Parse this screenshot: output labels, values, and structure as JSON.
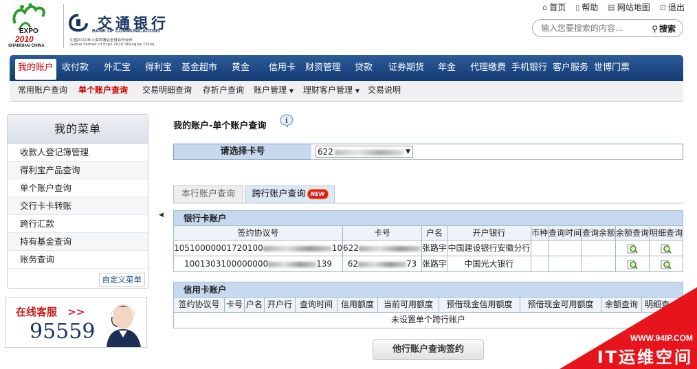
{
  "expo": {
    "line1": "EXPO",
    "line2": "2010",
    "line3": "SHANGHAI CHINA"
  },
  "bank": {
    "name_cn": "交通银行",
    "name_en": "BANK OF COMMUNICATIONS",
    "slogan_cn": "中国2010年上海世博会全球合作伙伴",
    "slogan_en": "Global Partner of Expo 2010 Shanghai China"
  },
  "toplinks": [
    {
      "icon": "home-icon",
      "label": "首页"
    },
    {
      "icon": "help-icon",
      "label": "帮助"
    },
    {
      "icon": "sitemap-icon",
      "label": "网站地图"
    },
    {
      "icon": "logout-icon",
      "label": "退出"
    }
  ],
  "search": {
    "placeholder": "输入您要搜索的内容...",
    "button": "搜索"
  },
  "nav": [
    "我的账户",
    "收付款",
    "外汇宝",
    "得利宝",
    "基金超市",
    "黄金",
    "信用卡",
    "财资管理",
    "贷款",
    "证券期货",
    "年金",
    "代理缴费",
    "手机银行",
    "客户服务",
    "世博门票"
  ],
  "subnav": [
    "常用账户查询",
    "单个账户查询",
    "交易明细查询",
    "存折户查询",
    "账户管理",
    "理财客户管理",
    "交易说明"
  ],
  "sidebar": {
    "title": "我的菜单",
    "items": [
      "收款人登记簿管理",
      "得利宝产品查询",
      "单个账户查询",
      "交行卡卡转账",
      "跨行汇款",
      "持有基金查询",
      "账务查询"
    ],
    "custom": "自定义菜单"
  },
  "service": {
    "label": "在线客服",
    "arrows": ">>",
    "phone": "95559"
  },
  "page_title": "我的账户-单个账户查询",
  "card_select": {
    "label": "请选择卡号",
    "value_prefix": "622"
  },
  "tabs": [
    {
      "label": "本行账户查询"
    },
    {
      "label": "跨行账户查询",
      "badge": "NEW"
    }
  ],
  "bank_cards": {
    "title": "银行卡账户",
    "columns": [
      "签约协议号",
      "卡号",
      "户名",
      "开户银行",
      "币种",
      "查询时间",
      "查询余额",
      "余额查询",
      "明细查询"
    ],
    "rows": [
      {
        "agreement_prefix": "10510000001720100",
        "agreement_suffix": "1006",
        "card_prefix": "622",
        "name": "张路宇",
        "bank": "中国建设银行安徽分行"
      },
      {
        "agreement_prefix": "1001303100000000",
        "agreement_suffix": "139",
        "card_prefix": "62",
        "card_suffix": "73",
        "name": "张路宇",
        "bank": "中国光大银行"
      }
    ]
  },
  "credit_cards": {
    "title": "信用卡账户",
    "columns": [
      "签约协议号",
      "卡号",
      "户名",
      "开户行",
      "查询时间",
      "信用额度",
      "当前可用额度",
      "预借现金信用额度",
      "预借现金可用额度",
      "余额查询",
      "明细查"
    ],
    "empty": "未设置单个跨行账户"
  },
  "bottom_button": "他行账户查询签约",
  "watermark": {
    "url": "WWW.94IP.COM",
    "text": "IT运维空间"
  },
  "colors": {
    "nav": "#1d4a86",
    "active": "#cc0000",
    "header_fill": "#c6d9ef",
    "watermark": "#e8141c"
  }
}
